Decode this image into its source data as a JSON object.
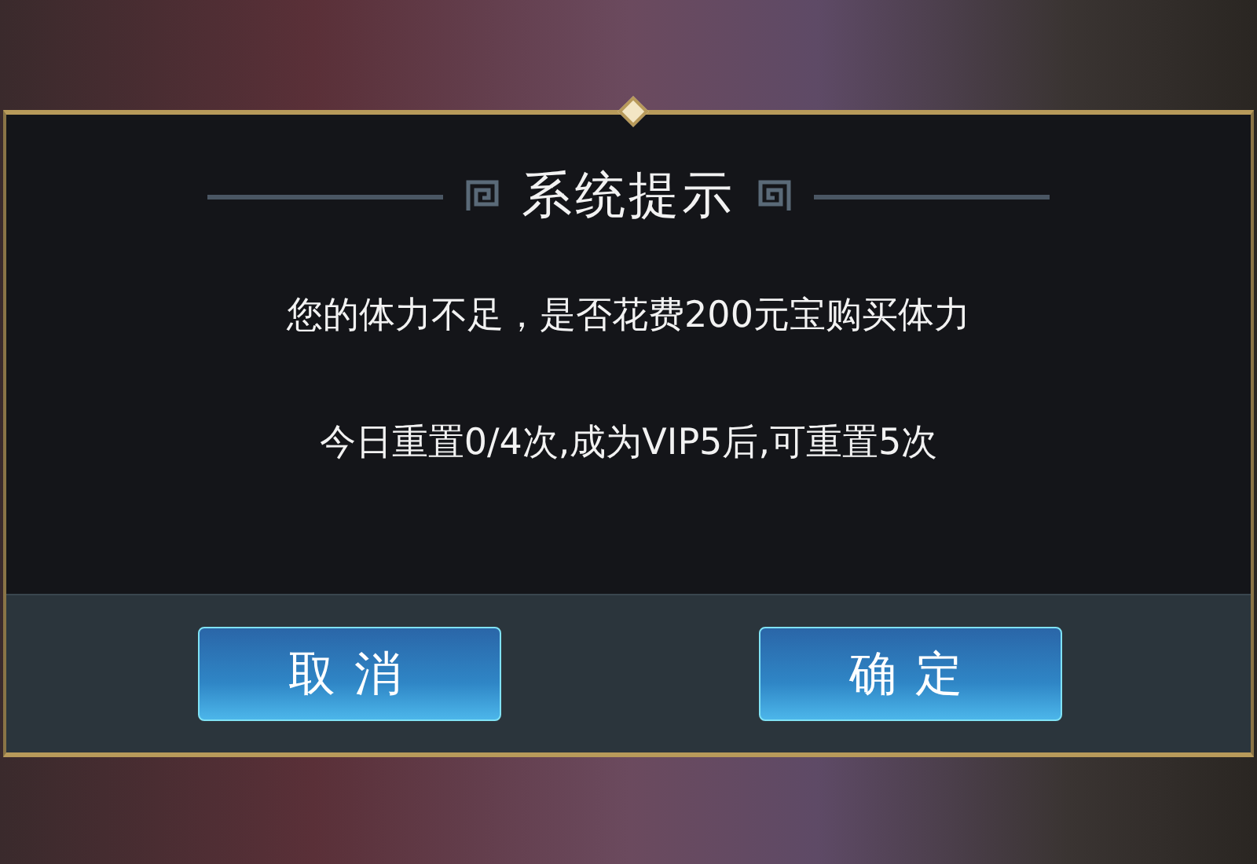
{
  "dialog": {
    "title": "系统提示",
    "messages": [
      "您的体力不足，是否花费200元宝购买体力",
      "今日重置0/4次,成为VIP5后,可重置5次"
    ],
    "buttons": [
      "取消",
      "确定"
    ]
  }
}
